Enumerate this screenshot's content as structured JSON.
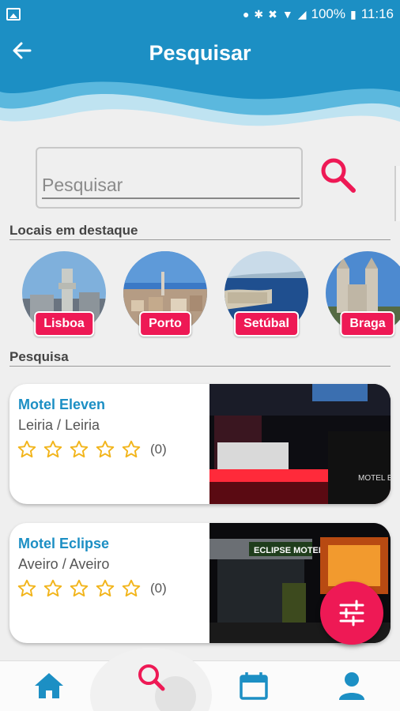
{
  "status_bar": {
    "battery": "100%",
    "time": "11:16"
  },
  "header": {
    "title": "Pesquisar"
  },
  "search": {
    "placeholder": "Pesquisar"
  },
  "featured": {
    "title": "Locais em destaque",
    "places": [
      {
        "name": "Lisboa"
      },
      {
        "name": "Porto"
      },
      {
        "name": "Setúbal"
      },
      {
        "name": "Braga"
      }
    ]
  },
  "results": {
    "title": "Pesquisa",
    "items": [
      {
        "name": "Motel Eleven",
        "location": "Leiria / Leiria",
        "rating_count": "(0)",
        "stars": 0,
        "photo_caption": "MOTEL ELEVEN"
      },
      {
        "name": "Motel Eclipse",
        "location": "Aveiro / Aveiro",
        "rating_count": "(0)",
        "stars": 0,
        "photo_caption": "ECLIPSE MOTEL"
      }
    ]
  },
  "colors": {
    "primary": "#1c8fc4",
    "accent": "#ee1955",
    "star": "#f2b51c"
  },
  "icons": {
    "back": "arrow-left-icon",
    "search": "search-icon",
    "filter": "sliders-icon",
    "nav": [
      "home-icon",
      "search-icon",
      "calendar-icon",
      "user-icon"
    ]
  }
}
